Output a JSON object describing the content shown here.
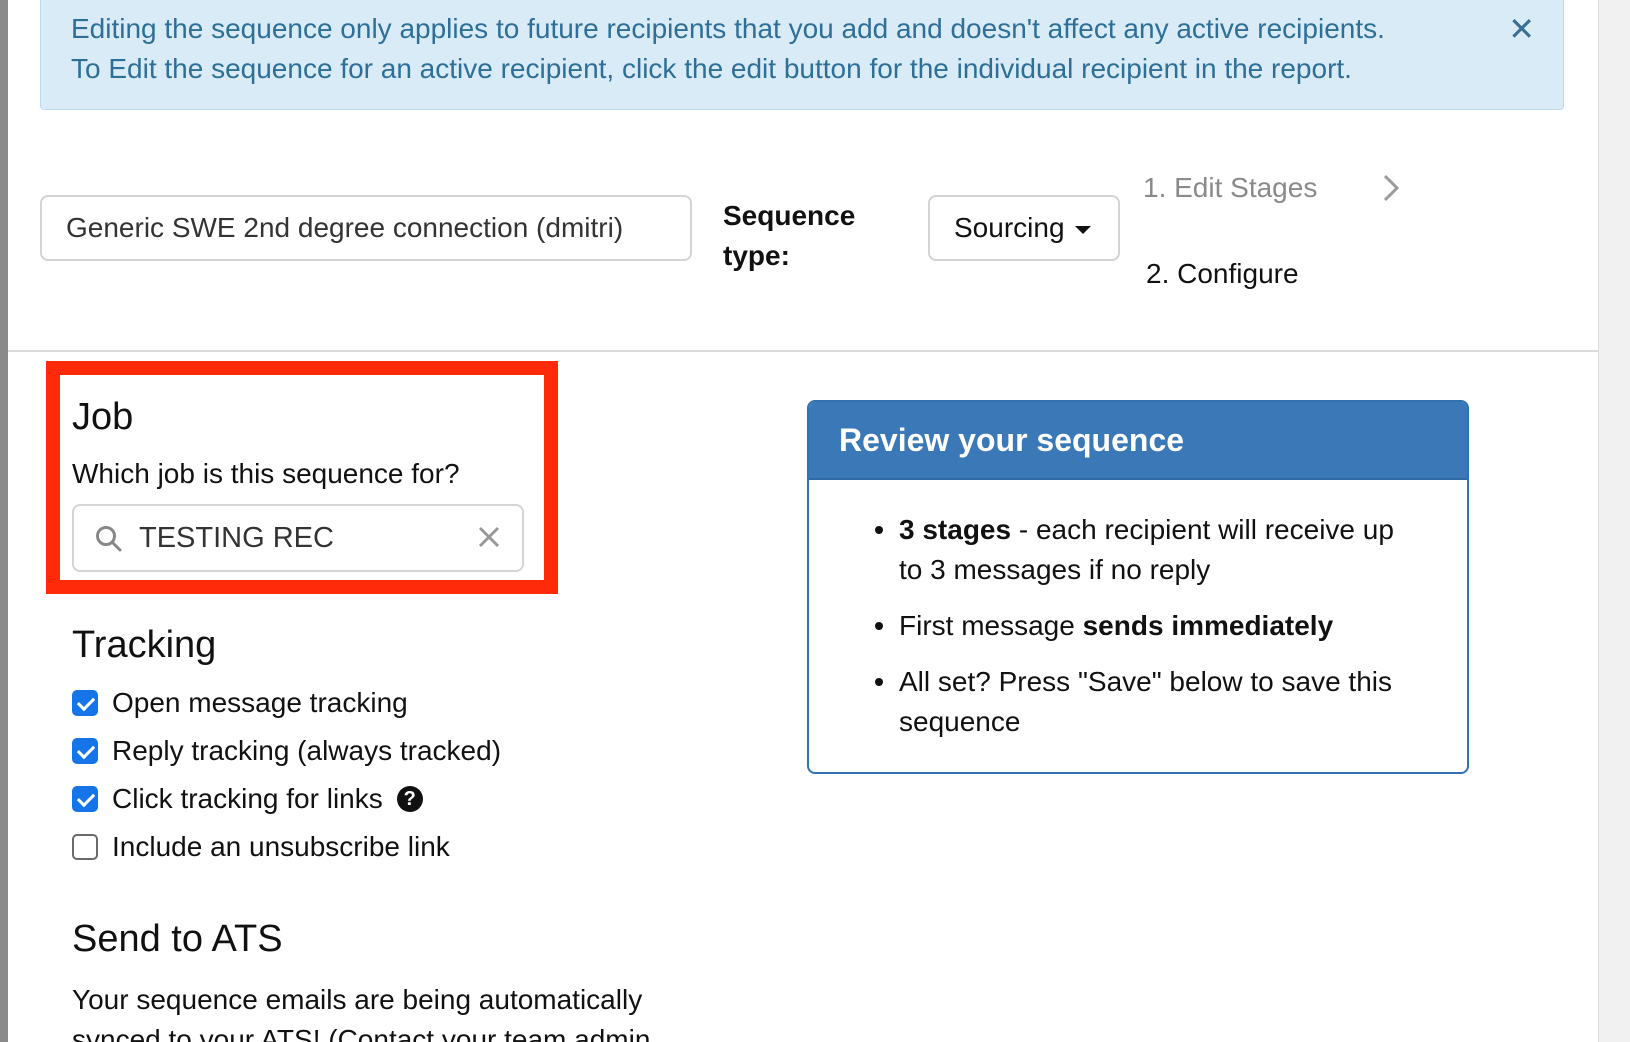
{
  "alert": {
    "line1": "Editing the sequence only applies to future recipients that you add and doesn't affect any active recipients.",
    "line2": "To Edit the sequence for an active recipient, click the edit button for the individual recipient in the report.",
    "close_glyph": "✕"
  },
  "header": {
    "sequence_name": "Generic SWE 2nd degree connection (dmitri)",
    "sequence_type_label": "Sequence type:",
    "sequence_type_value": "Sourcing",
    "steps": [
      {
        "label": "1. Edit Stages",
        "state": "inactive"
      },
      {
        "label": "2. Configure",
        "state": "active"
      }
    ]
  },
  "job": {
    "title": "Job",
    "prompt": "Which job is this sequence for?",
    "selected": "TESTING REC",
    "highlight_color": "#ff2a0a"
  },
  "tracking": {
    "title": "Tracking",
    "options": [
      {
        "label": "Open message tracking",
        "checked": true
      },
      {
        "label": "Reply tracking (always tracked)",
        "checked": true
      },
      {
        "label": "Click tracking for links",
        "checked": true,
        "help": "?"
      },
      {
        "label": "Include an unsubscribe link",
        "checked": false
      }
    ]
  },
  "review": {
    "title": "Review your sequence",
    "items": [
      {
        "bold": "3 stages",
        "text": " - each recipient will receive up to 3 messages if no reply"
      },
      {
        "prefix": "First message ",
        "bold": "sends immediately"
      },
      {
        "text": "All set? Press \"Save\" below to save this sequence"
      }
    ]
  },
  "ats": {
    "title": "Send to ATS",
    "text": "Your sequence emails are being automatically synced to your ATS! (Contact your team admin"
  },
  "colors": {
    "alert_bg": "#d9ebf6",
    "alert_text": "#2e6f98",
    "review_header": "#3a78b7",
    "checkbox": "#1574e8"
  }
}
